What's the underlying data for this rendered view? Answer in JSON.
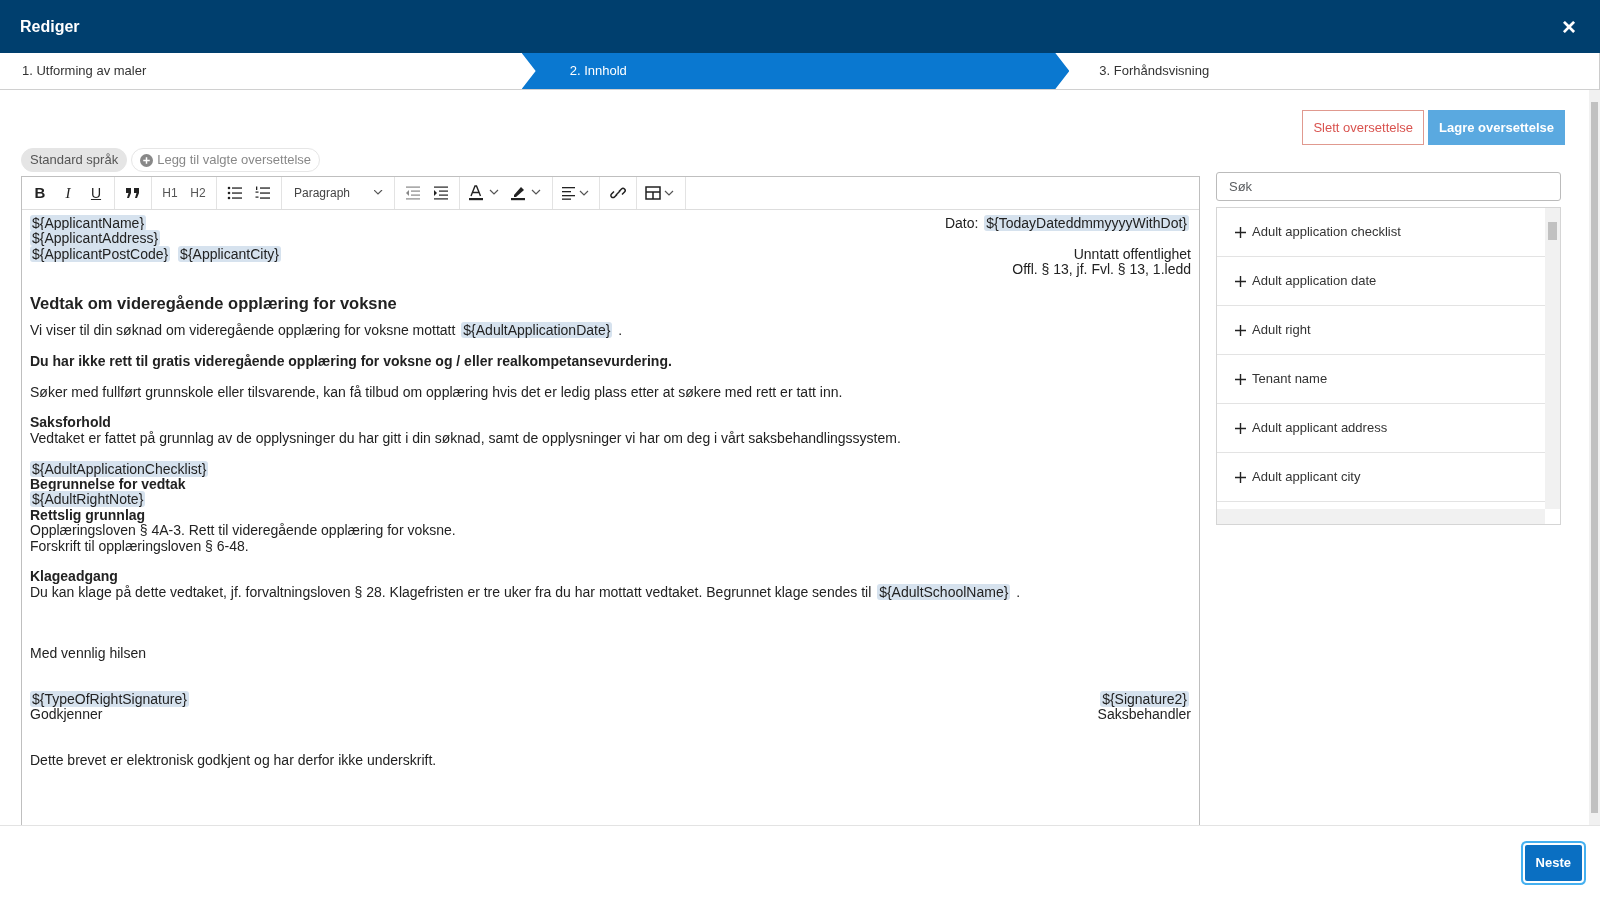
{
  "window": {
    "title": "Rediger",
    "close": "×"
  },
  "steps": [
    {
      "label": "1. Utforming av maler",
      "selected": false
    },
    {
      "label": "2. Innhold",
      "selected": true
    },
    {
      "label": "3. Forhåndsvisning",
      "selected": false
    }
  ],
  "actions": [
    {
      "label": "Slett oversettelse",
      "kind": "danger"
    },
    {
      "label": "Lagre oversettelse",
      "kind": "primary"
    }
  ],
  "language_tabs": [
    {
      "label": "Standard språk",
      "kind": "language",
      "selected": true
    },
    {
      "label": "Legg til valgte oversettelse",
      "kind": "add",
      "selected": false
    }
  ],
  "toolbar": [
    [
      {
        "kind": "bold",
        "label": "B"
      },
      {
        "kind": "italic",
        "label": "I"
      },
      {
        "kind": "underline",
        "label": "U"
      }
    ],
    [
      {
        "kind": "quote"
      }
    ],
    [
      {
        "kind": "text",
        "label": "H1"
      },
      {
        "kind": "text",
        "label": "H2"
      }
    ],
    [
      {
        "kind": "bullets"
      },
      {
        "kind": "numbers"
      }
    ],
    [
      {
        "kind": "select",
        "label": "Paragraph"
      }
    ],
    [
      {
        "kind": "outdent"
      },
      {
        "kind": "indent"
      }
    ],
    [
      {
        "kind": "text-color"
      },
      {
        "kind": "highlight"
      }
    ],
    [
      {
        "kind": "align"
      }
    ],
    [
      {
        "kind": "link"
      }
    ],
    [
      {
        "kind": "table"
      }
    ]
  ],
  "document": [
    {
      "kind": "columns",
      "left": [
        {
          "lines": [
            {
              "kind": "plain",
              "parts": [
                {
                  "text": "${ApplicantName}",
                  "var": true
                }
              ]
            },
            {
              "kind": "plain",
              "parts": [
                {
                  "text": "${ApplicantAddress}",
                  "var": true
                }
              ]
            },
            {
              "kind": "plain",
              "parts": [
                {
                  "text": "${ApplicantPostCode}",
                  "var": true
                },
                {
                  "text": "${ApplicantCity}",
                  "var": true
                }
              ]
            }
          ]
        }
      ],
      "right": [
        {
          "lines": [
            {
              "kind": "plain",
              "parts": [
                {
                  "text": "Dato:",
                  "var": false
                },
                {
                  "text": "${TodayDateddmmyyyyWithDot}",
                  "var": true
                }
              ]
            }
          ]
        },
        {
          "lines": [
            {
              "kind": "plain",
              "parts": [
                {
                  "text": "Unntatt offentlighet",
                  "var": false
                }
              ]
            },
            {
              "kind": "plain",
              "parts": [
                {
                  "text": "Offl. § 13, jf. Fvl. § 13, 1.ledd",
                  "var": false
                }
              ]
            }
          ]
        }
      ]
    },
    {
      "kind": "heading",
      "lines": [
        {
          "kind": "bold",
          "parts": [
            {
              "text": "Vedtak om videregående opplæring for voksne",
              "var": false
            }
          ]
        }
      ]
    },
    {
      "kind": "text",
      "lines": [
        {
          "kind": "plain",
          "parts": [
            {
              "text": "Vi viser til din søknad om videregående opplæring for voksne mottatt",
              "var": false
            },
            {
              "text": "${AdultApplicationDate}",
              "var": true
            },
            {
              "text": ".",
              "var": false
            }
          ]
        }
      ]
    },
    {
      "kind": "text",
      "lines": [
        {
          "kind": "bold",
          "parts": [
            {
              "text": "Du har ikke rett til gratis videregående opplæring for voksne og / eller realkompetansevurdering.",
              "var": false
            }
          ]
        }
      ]
    },
    {
      "kind": "text",
      "lines": [
        {
          "kind": "plain",
          "parts": [
            {
              "text": "Søker med fullført grunnskole eller tilsvarende, kan få tilbud om opplæring hvis det er ledig plass etter at søkere med rett er tatt inn.",
              "var": false
            }
          ]
        }
      ]
    },
    {
      "kind": "text",
      "lines": [
        {
          "kind": "bold",
          "parts": [
            {
              "text": "Saksforhold",
              "var": false
            }
          ]
        },
        {
          "kind": "plain",
          "parts": [
            {
              "text": "Vedtaket er fattet på grunnlag av de opplysninger du har gitt i din søknad, samt de opplysninger vi har om deg i vårt saksbehandlingssystem.",
              "var": false
            }
          ]
        }
      ]
    },
    {
      "kind": "text",
      "lines": [
        {
          "kind": "plain",
          "parts": [
            {
              "text": "${AdultApplicationChecklist}",
              "var": true
            }
          ]
        },
        {
          "kind": "bold",
          "parts": [
            {
              "text": "Begrunnelse for vedtak",
              "var": false
            }
          ]
        },
        {
          "kind": "plain",
          "parts": [
            {
              "text": "${AdultRightNote}",
              "var": true
            }
          ]
        },
        {
          "kind": "bold",
          "parts": [
            {
              "text": "Rettslig grunnlag",
              "var": false
            }
          ]
        },
        {
          "kind": "plain",
          "parts": [
            {
              "text": "Opplæringsloven § 4A-3. Rett til videregående opplæring for voksne.",
              "var": false
            }
          ]
        },
        {
          "kind": "plain",
          "parts": [
            {
              "text": "Forskrift til opplæringsloven § 6-48.",
              "var": false
            }
          ]
        }
      ]
    },
    {
      "kind": "text",
      "lines": [
        {
          "kind": "bold",
          "parts": [
            {
              "text": "Klageadgang",
              "var": false
            }
          ]
        },
        {
          "kind": "plain",
          "parts": [
            {
              "text": "Du kan klage på dette vedtaket, jf. forvaltningsloven § 28. Klagefristen er tre uker fra du har mottatt vedtaket. Begrunnet klage sendes til",
              "var": false
            },
            {
              "text": "${AdultSchoolName}",
              "var": true
            },
            {
              "text": ".",
              "var": false
            }
          ]
        }
      ]
    },
    {
      "kind": "blank"
    },
    {
      "kind": "text",
      "lines": [
        {
          "kind": "plain",
          "parts": [
            {
              "text": "Med vennlig hilsen",
              "var": false
            }
          ]
        }
      ]
    },
    {
      "kind": "columns",
      "left": [
        {
          "lines": [
            {
              "kind": "plain",
              "parts": [
                {
                  "text": "${TypeOfRightSignature}",
                  "var": true
                }
              ]
            },
            {
              "kind": "plain",
              "parts": [
                {
                  "text": "Godkjenner",
                  "var": false
                }
              ]
            }
          ]
        }
      ],
      "right": [
        {
          "lines": [
            {
              "kind": "plain",
              "parts": [
                {
                  "text": "${Signature2}",
                  "var": true
                }
              ]
            },
            {
              "kind": "plain",
              "parts": [
                {
                  "text": "Saksbehandler",
                  "var": false
                }
              ]
            }
          ]
        }
      ]
    },
    {
      "kind": "text",
      "lines": [
        {
          "kind": "plain",
          "parts": [
            {
              "text": "Dette brevet er elektronisk godkjent og har derfor ikke underskrift.",
              "var": false
            }
          ]
        }
      ]
    }
  ],
  "search": {
    "placeholder": "Søk"
  },
  "fields": [
    {
      "label": "Adult application checklist"
    },
    {
      "label": "Adult application date"
    },
    {
      "label": "Adult right"
    },
    {
      "label": "Tenant name"
    },
    {
      "label": "Adult applicant address"
    },
    {
      "label": "Adult applicant city"
    }
  ],
  "footer": {
    "button": "Neste"
  }
}
